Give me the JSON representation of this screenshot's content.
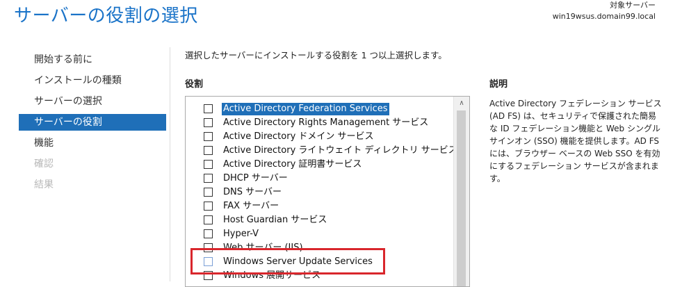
{
  "header": {
    "title": "サーバーの役割の選択",
    "target_label": "対象サーバー",
    "target_value": "win19wsus.domain99.local"
  },
  "nav": {
    "items": [
      {
        "label": "開始する前に",
        "state": "normal"
      },
      {
        "label": "インストールの種類",
        "state": "normal"
      },
      {
        "label": "サーバーの選択",
        "state": "normal"
      },
      {
        "label": "サーバーの役割",
        "state": "active"
      },
      {
        "label": "機能",
        "state": "normal"
      },
      {
        "label": "確認",
        "state": "disabled"
      },
      {
        "label": "結果",
        "state": "disabled"
      }
    ]
  },
  "main": {
    "instruction": "選択したサーバーにインストールする役割を 1 つ以上選択します。",
    "roles_heading": "役割",
    "description_heading": "説明",
    "description_text": "Active Directory フェデレーション サービス (AD FS) は、セキュリティで保護された簡易な ID フェデレーション機能と Web シングル サインオン (SSO) 機能を提供します。AD FS には、ブラウザー ベースの Web SSO を有効にするフェデレーション サービスが含まれます。"
  },
  "roles": [
    {
      "label": "Active Directory Federation Services",
      "checked": false,
      "selected": true
    },
    {
      "label": "Active Directory Rights Management サービス",
      "checked": false
    },
    {
      "label": "Active Directory ドメイン サービス",
      "checked": false
    },
    {
      "label": "Active Directory ライトウェイト ディレクトリ サービス",
      "checked": false
    },
    {
      "label": "Active Directory 証明書サービス",
      "checked": false
    },
    {
      "label": "DHCP サーバー",
      "checked": false
    },
    {
      "label": "DNS サーバー",
      "checked": false
    },
    {
      "label": "FAX サーバー",
      "checked": false
    },
    {
      "label": "Host Guardian サービス",
      "checked": false
    },
    {
      "label": "Hyper-V",
      "checked": false
    },
    {
      "label": "Web サーバー (IIS)",
      "checked": false
    },
    {
      "label": "Windows Server Update Services",
      "checked": false,
      "highlighted": true
    },
    {
      "label": "Windows 展開サービス",
      "checked": false
    }
  ],
  "colors": {
    "accent": "#1f6fb8",
    "title": "#1a73c8",
    "highlight_box": "#d9262c"
  },
  "icons": {
    "scroll_up": "chevron-up-icon"
  }
}
